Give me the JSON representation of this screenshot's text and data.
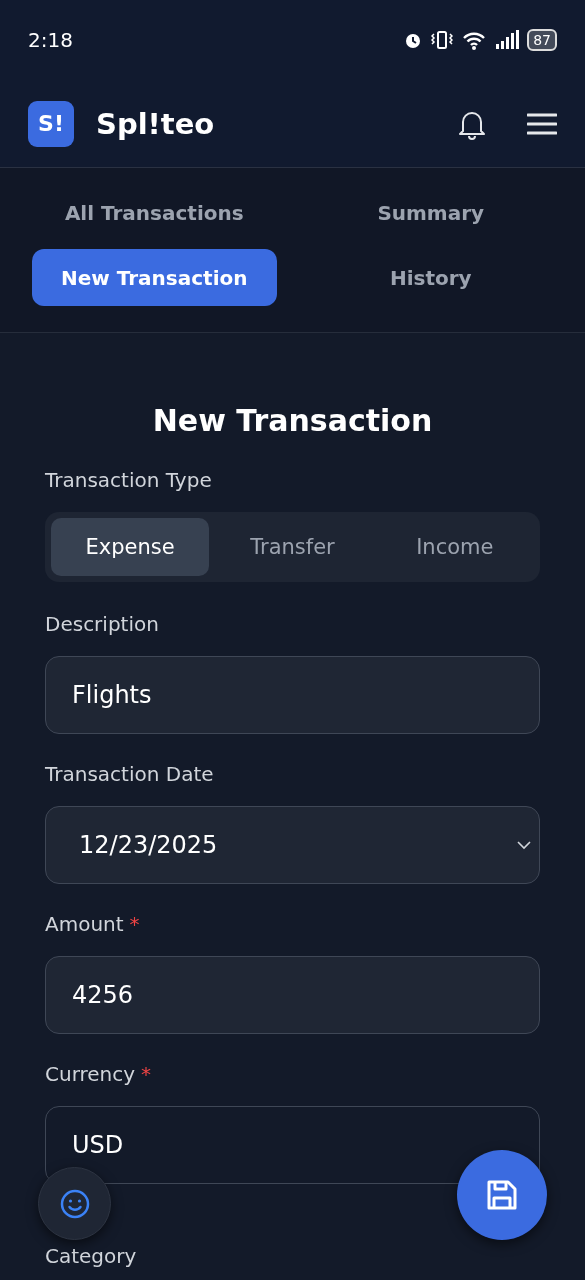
{
  "status_bar": {
    "time": "2:18",
    "battery": "87"
  },
  "app": {
    "logo": "S!",
    "name": "Spl!teo"
  },
  "nav_tabs": [
    {
      "label": "All Transactions",
      "selected": false
    },
    {
      "label": "Summary",
      "selected": false
    },
    {
      "label": "New Transaction",
      "selected": true
    },
    {
      "label": "History",
      "selected": false
    }
  ],
  "form": {
    "title": "New Transaction",
    "type_label": "Transaction Type",
    "types": [
      {
        "label": "Expense",
        "selected": true
      },
      {
        "label": "Transfer",
        "selected": false
      },
      {
        "label": "Income",
        "selected": false
      }
    ],
    "fields": [
      {
        "label": "Description",
        "kind": "text",
        "value": "Flights"
      },
      {
        "label": "Transaction Date",
        "kind": "date",
        "value": "12/23/2025"
      },
      {
        "label": "Amount",
        "kind": "text",
        "value": "4256",
        "mark": "*"
      },
      {
        "label": "Currency",
        "kind": "text",
        "value": "USD",
        "mark": "*"
      }
    ],
    "next_label": "Category"
  }
}
